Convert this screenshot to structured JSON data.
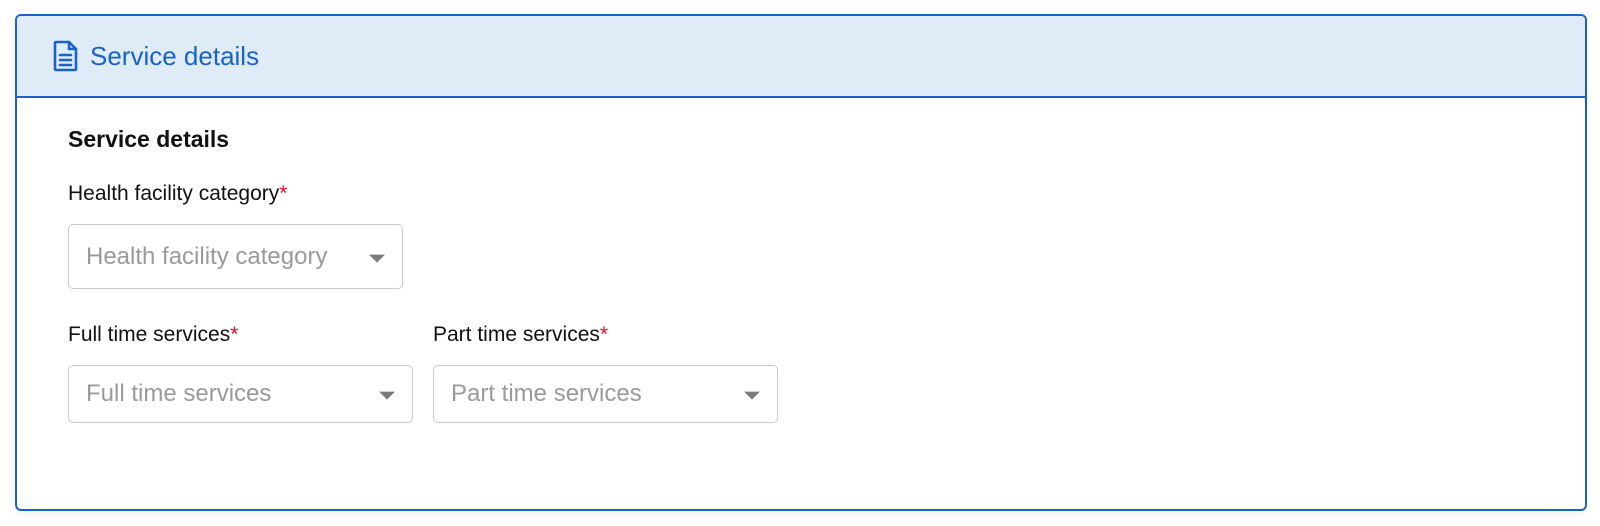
{
  "panel": {
    "header_title": "Service details",
    "header_icon": "document-icon",
    "accent_color": "#1a61c8",
    "header_background": "#dfecf8"
  },
  "form": {
    "section_title": "Service details",
    "required_marker": "*",
    "fields": {
      "health_facility_category": {
        "label": "Health facility category",
        "placeholder": "Health facility category"
      },
      "full_time_services": {
        "label": "Full time services",
        "placeholder": "Full time services"
      },
      "part_time_services": {
        "label": "Part time services",
        "placeholder": "Part time services"
      }
    }
  }
}
